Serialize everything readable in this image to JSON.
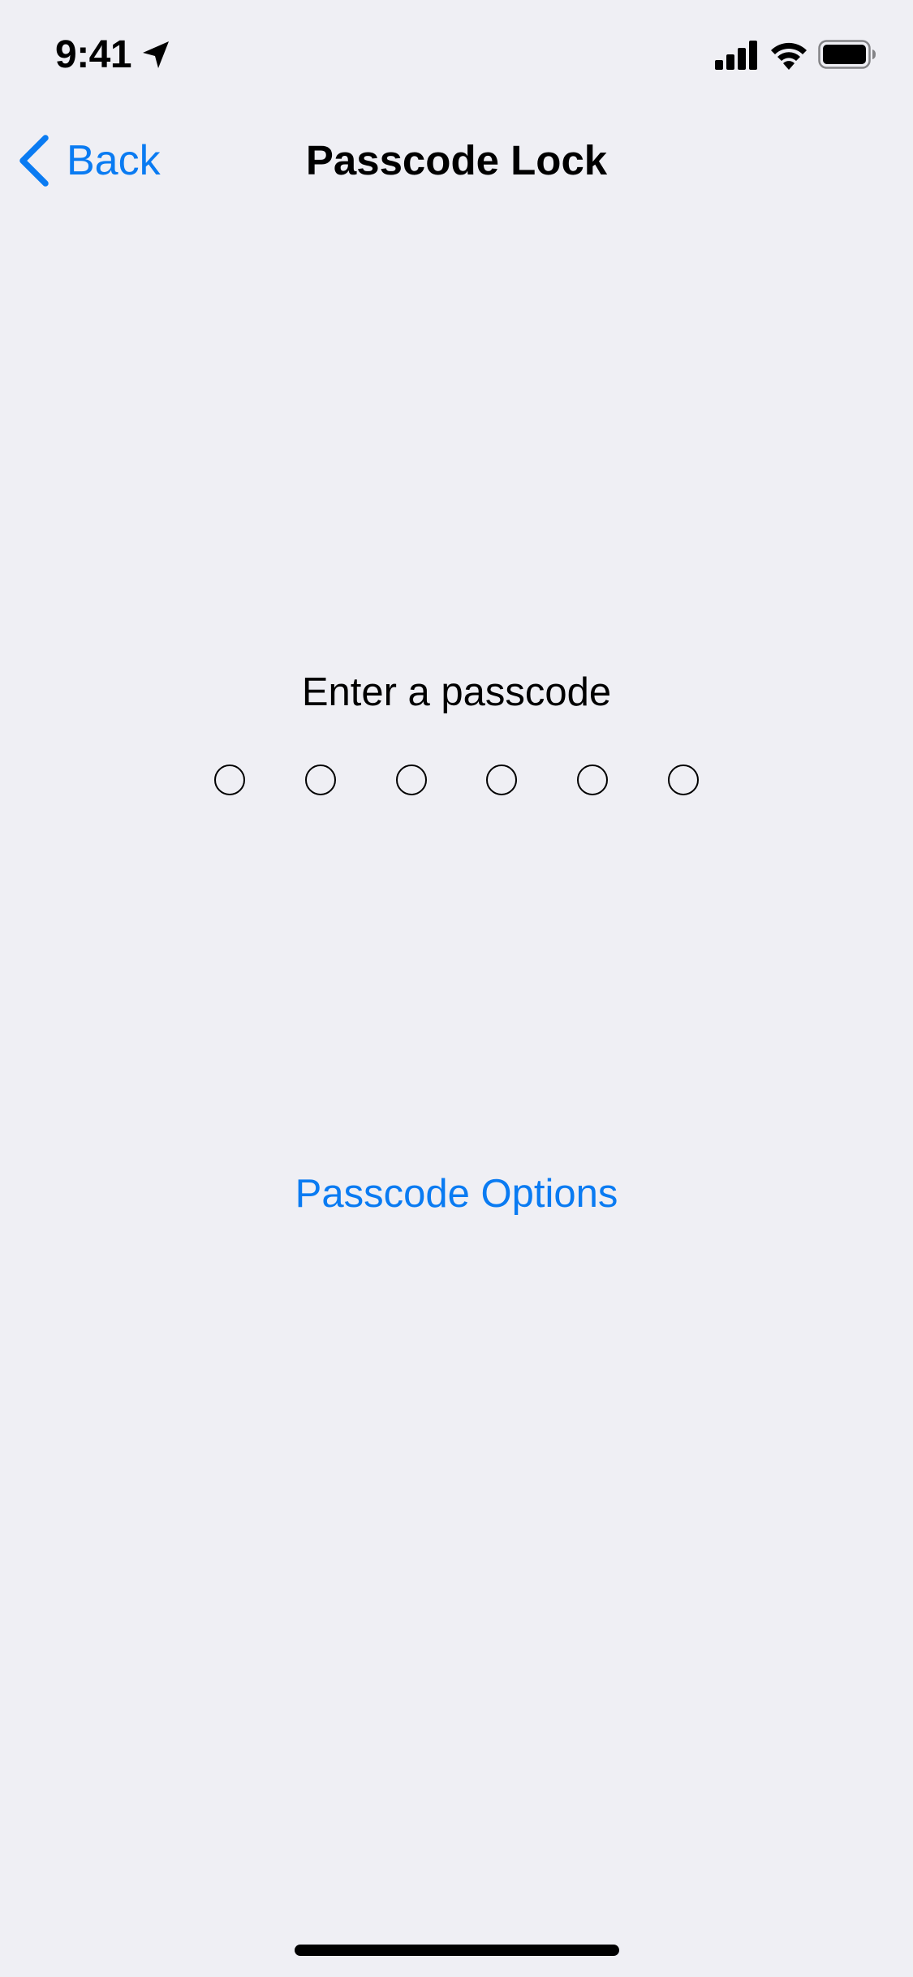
{
  "status_bar": {
    "time": "9:41",
    "icons": [
      "location-icon",
      "signal-icon",
      "wifi-icon",
      "battery-icon"
    ]
  },
  "nav": {
    "back_label": "Back",
    "title": "Passcode Lock"
  },
  "passcode": {
    "prompt": "Enter a passcode",
    "length": 6,
    "entered": 0
  },
  "options": {
    "label": "Passcode Options"
  },
  "colors": {
    "accent": "#0a7bf2",
    "background": "#efeff4",
    "text": "#000000"
  }
}
